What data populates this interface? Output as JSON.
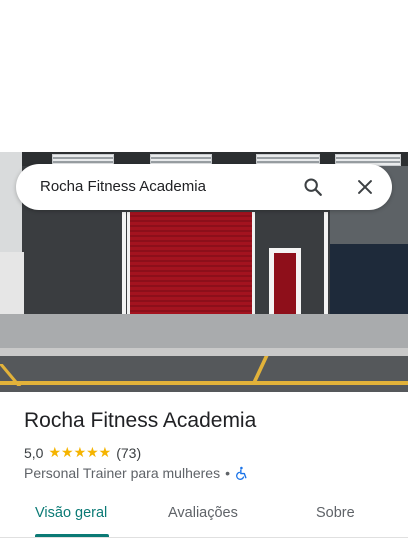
{
  "search": {
    "query": "Rocha Fitness Academia"
  },
  "place": {
    "name": "Rocha Fitness Academia",
    "rating": "5,0",
    "stars": "★★★★★",
    "review_count": "(73)",
    "category": "Personal Trainer para mulheres",
    "separator": "•"
  },
  "tabs": [
    {
      "label": "Visão geral",
      "active": true
    },
    {
      "label": "Avaliações",
      "active": false
    },
    {
      "label": "Sobre",
      "active": false
    }
  ],
  "colors": {
    "accent": "#0b7a75",
    "star": "#f5b400",
    "accessibility_icon": "#1a73e8"
  },
  "icons": {
    "search": "search-icon",
    "close": "close-icon",
    "accessibility": "wheelchair-icon"
  }
}
